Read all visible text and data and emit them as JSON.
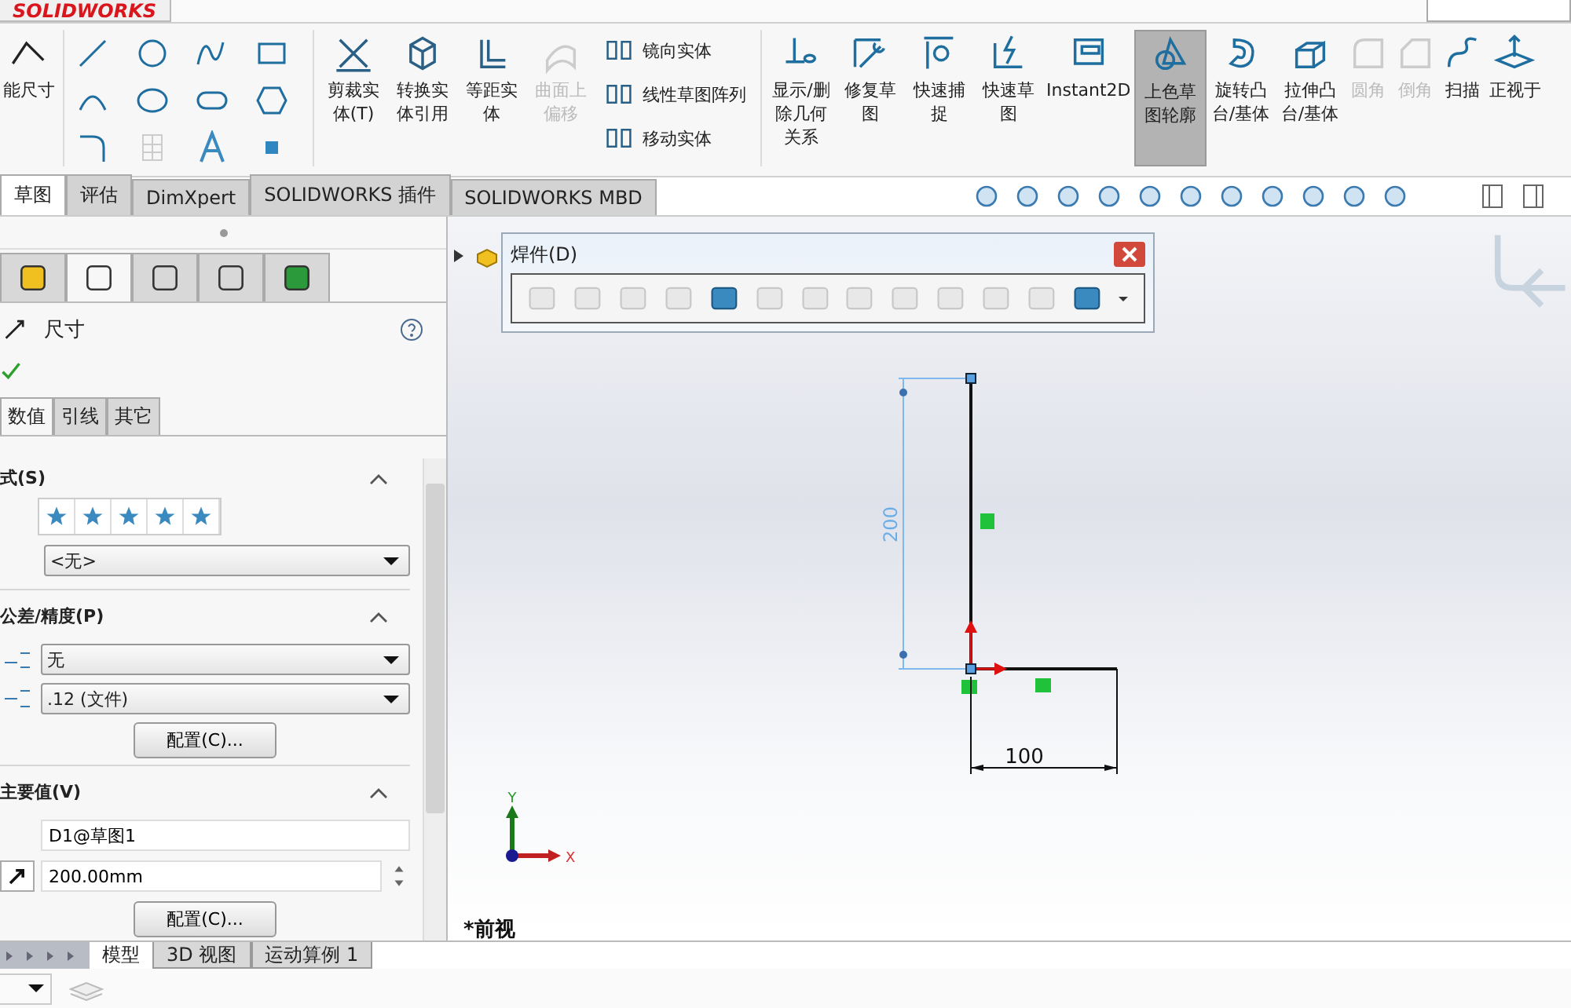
{
  "app": {
    "logo": "SOLIDWORKS"
  },
  "ribbon": {
    "smart_dimension": {
      "label": "能尺寸"
    },
    "tools_a": [
      {
        "label": "剪裁实体(T)",
        "disabled": false
      },
      {
        "label": "转换实体引用",
        "disabled": false
      },
      {
        "label": "等距实体",
        "disabled": false
      },
      {
        "label": "曲面上偏移",
        "disabled": true
      }
    ],
    "small_tools": [
      {
        "label": "镜向实体"
      },
      {
        "label": "线性草图阵列"
      },
      {
        "label": "移动实体"
      }
    ],
    "tools_b": [
      {
        "label": "显示/删除几何关系",
        "selected": false,
        "disabled": false
      },
      {
        "label": "修复草图",
        "selected": false,
        "disabled": false
      },
      {
        "label": "快速捕捉",
        "selected": false,
        "disabled": false
      },
      {
        "label": "快速草图",
        "selected": false,
        "disabled": false
      },
      {
        "label": "Instant2D",
        "selected": false,
        "disabled": false
      },
      {
        "label": "上色草图轮廓",
        "selected": true,
        "disabled": false
      },
      {
        "label": "旋转凸台/基体",
        "selected": false,
        "disabled": false
      },
      {
        "label": "拉伸凸台/基体",
        "selected": false,
        "disabled": false
      },
      {
        "label": "圆角",
        "selected": false,
        "disabled": true
      },
      {
        "label": "倒角",
        "selected": false,
        "disabled": true
      },
      {
        "label": "扫描",
        "selected": false,
        "disabled": false
      },
      {
        "label": "正视于",
        "selected": false,
        "disabled": false
      }
    ]
  },
  "tabs": [
    {
      "label": "草图",
      "selected": true
    },
    {
      "label": "评估",
      "selected": false
    },
    {
      "label": "DimXpert",
      "selected": false
    },
    {
      "label": "SOLIDWORKS 插件",
      "selected": false
    },
    {
      "label": "SOLIDWORKS MBD",
      "selected": false
    }
  ],
  "property_manager": {
    "tabs": [
      {
        "selected": false
      },
      {
        "selected": true
      },
      {
        "selected": false
      },
      {
        "selected": false
      },
      {
        "selected": false
      }
    ],
    "title": "尺寸",
    "subtabs": [
      {
        "label": "数值",
        "selected": true
      },
      {
        "label": "引线",
        "selected": false
      },
      {
        "label": "其它",
        "selected": false
      }
    ],
    "style_section": {
      "title": "式(S)",
      "dropdown": "<无>"
    },
    "tolerance_section": {
      "title": "公差/精度(P)",
      "tolerance": "无",
      "precision": ".12 (文件)",
      "button": "配置(C)..."
    },
    "primary_value_section": {
      "title": "主要值(V)",
      "name": "D1@草图1",
      "value": "200.00mm",
      "button": "配置(C)..."
    }
  },
  "weldment_toolbar": {
    "title": "焊件(D)"
  },
  "sketch": {
    "vertical_dimension": "200",
    "horizontal_dimension": "100",
    "triad_x": "X",
    "triad_y": "Y",
    "view_label": "*前视"
  },
  "bottom_tabs": [
    {
      "label": "模型",
      "selected": true
    },
    {
      "label": "3D 视图",
      "selected": false
    },
    {
      "label": "运动算例 1",
      "selected": false
    }
  ]
}
